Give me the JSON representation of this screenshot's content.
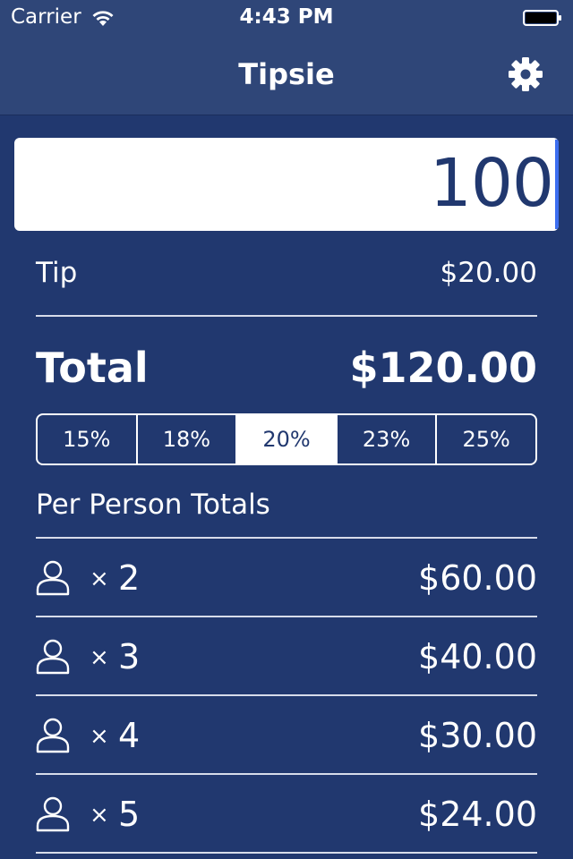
{
  "status_bar": {
    "carrier": "Carrier",
    "time": "4:43 PM"
  },
  "nav": {
    "title": "Tipsie",
    "settings_icon": "gear-icon"
  },
  "bill": {
    "amount": "100"
  },
  "tip": {
    "label": "Tip",
    "value": "$20.00"
  },
  "total": {
    "label": "Total",
    "value": "$120.00"
  },
  "tip_options": {
    "options": [
      "15%",
      "18%",
      "20%",
      "23%",
      "25%"
    ],
    "selected": "20%"
  },
  "per_person": {
    "title": "Per Person Totals",
    "times_symbol": "×",
    "rows": [
      {
        "count": "2",
        "amount": "$60.00"
      },
      {
        "count": "3",
        "amount": "$40.00"
      },
      {
        "count": "4",
        "amount": "$30.00"
      },
      {
        "count": "5",
        "amount": "$24.00"
      }
    ]
  },
  "colors": {
    "background": "#21386f",
    "nav": "#2f4678",
    "cursor": "#3c6ef0",
    "text": "#ffffff"
  }
}
